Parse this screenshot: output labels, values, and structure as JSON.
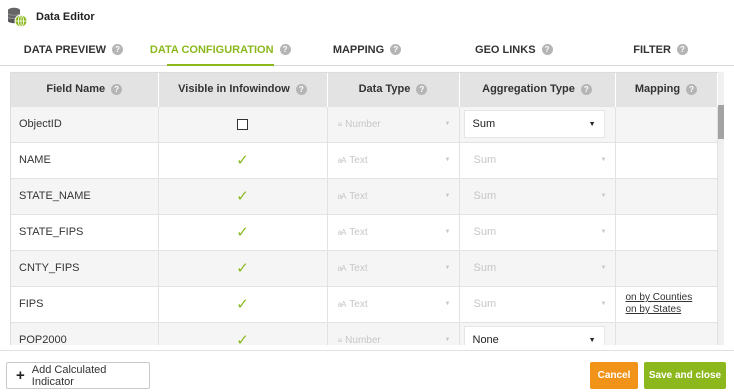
{
  "window": {
    "title": "Data Editor",
    "icon": "database-globe-icon"
  },
  "tabs": [
    {
      "label": "DATA PREVIEW",
      "active": false
    },
    {
      "label": "DATA CONFIGURATION",
      "active": true
    },
    {
      "label": "MAPPING",
      "active": false
    },
    {
      "label": "GEO LINKS",
      "active": false
    },
    {
      "label": "FILTER",
      "active": false
    }
  ],
  "columns": {
    "field_name": "Field Name",
    "visible": "Visible in Infowindow",
    "data_type": "Data Type",
    "aggregation": "Aggregation Type",
    "mapping": "Mapping"
  },
  "rows": [
    {
      "field": "ObjectID",
      "visible": false,
      "data_type": "Number",
      "data_type_icon": "number-icon",
      "aggregation": "Sum",
      "aggregation_enabled": true,
      "mapping": []
    },
    {
      "field": "NAME",
      "visible": true,
      "data_type": "Text",
      "data_type_icon": "text-icon",
      "aggregation": "Sum",
      "aggregation_enabled": false,
      "mapping": []
    },
    {
      "field": "STATE_NAME",
      "visible": true,
      "data_type": "Text",
      "data_type_icon": "text-icon",
      "aggregation": "Sum",
      "aggregation_enabled": false,
      "mapping": []
    },
    {
      "field": "STATE_FIPS",
      "visible": true,
      "data_type": "Text",
      "data_type_icon": "text-icon",
      "aggregation": "Sum",
      "aggregation_enabled": false,
      "mapping": []
    },
    {
      "field": "CNTY_FIPS",
      "visible": true,
      "data_type": "Text",
      "data_type_icon": "text-icon",
      "aggregation": "Sum",
      "aggregation_enabled": false,
      "mapping": []
    },
    {
      "field": "FIPS",
      "visible": true,
      "data_type": "Text",
      "data_type_icon": "text-icon",
      "aggregation": "Sum",
      "aggregation_enabled": false,
      "mapping": [
        "on by Counties",
        "on by States"
      ]
    },
    {
      "field": "POP2000",
      "visible": true,
      "data_type": "Number",
      "data_type_icon": "number-icon",
      "aggregation": "None",
      "aggregation_enabled": true,
      "mapping": []
    }
  ],
  "footer": {
    "add_label": "Add Calculated Indicator",
    "cancel_label": "Cancel",
    "save_label": "Save and close"
  },
  "colors": {
    "accent_green": "#8cb81e",
    "cancel_orange": "#f29319",
    "header_gray": "#e3e3e3"
  }
}
